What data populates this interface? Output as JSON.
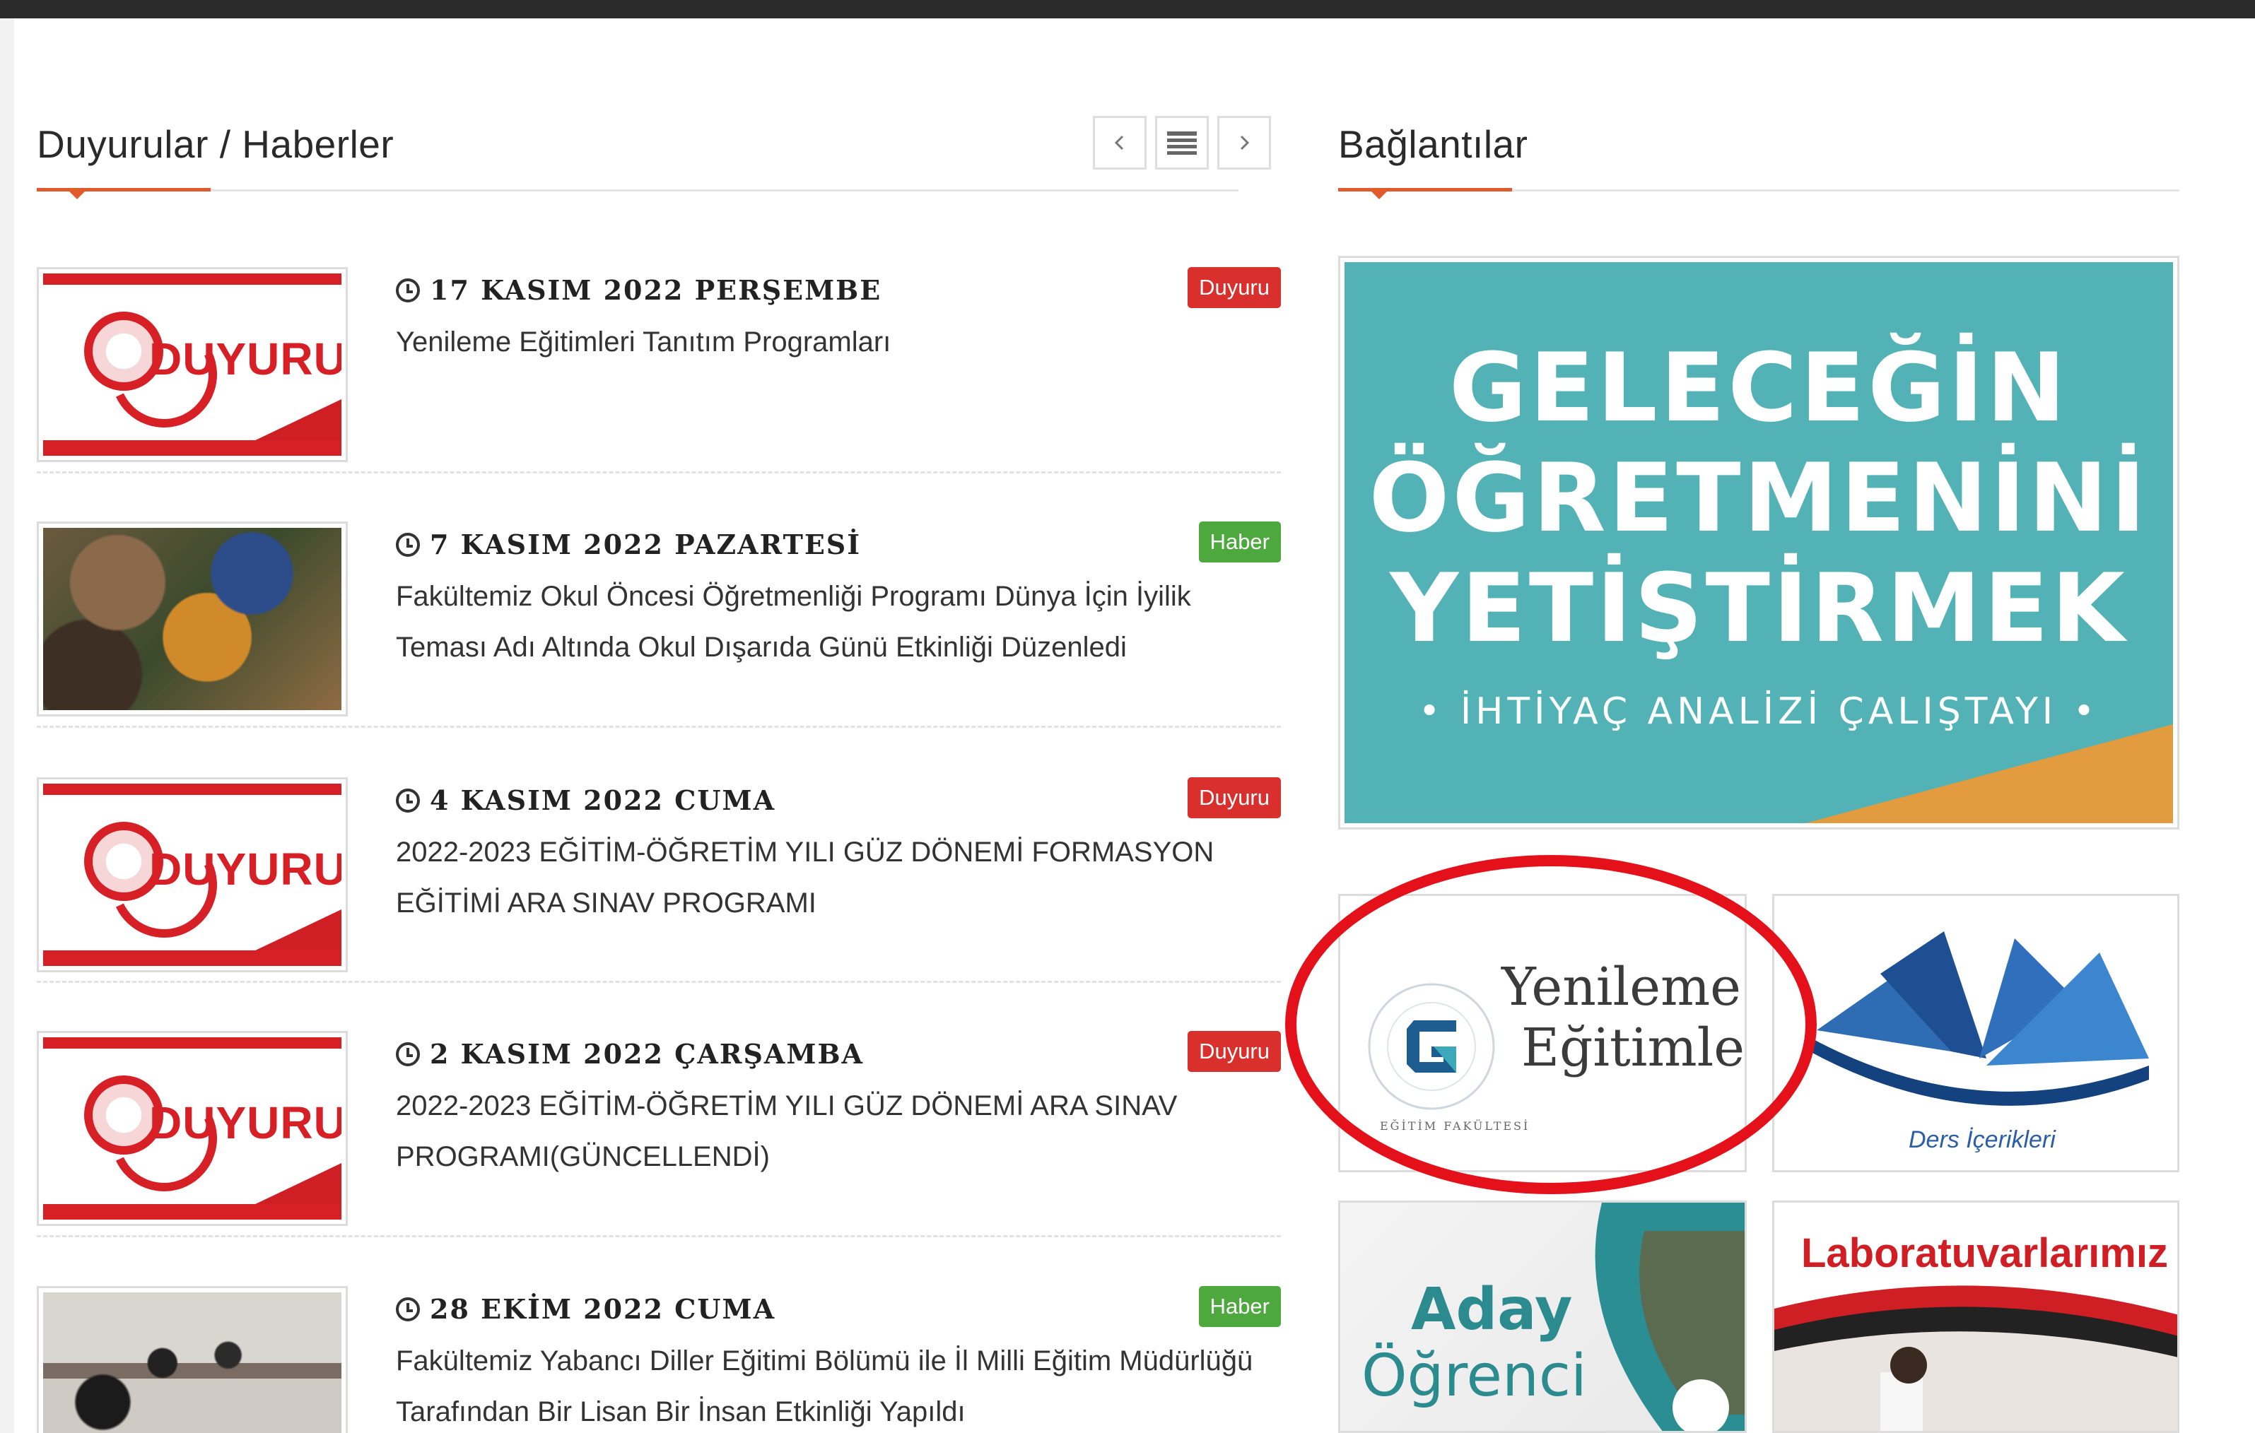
{
  "news": {
    "title": "Duyurular / Haberler",
    "nav": {
      "prev_icon": "chevron-left-icon",
      "list_icon": "list-icon",
      "next_icon": "chevron-right-icon"
    },
    "items": [
      {
        "thumb": "duyuru",
        "thumb_text": "DUYURU",
        "date": "17 KASIM 2022 PERŞEMBE",
        "headline": "Yenileme Eğitimleri Tanıtım Programları",
        "badge": "Duyuru",
        "badge_color": "#d9302d"
      },
      {
        "thumb": "photo",
        "date": "7 KASIM 2022 PAZARTESİ",
        "headline": "Fakültemiz Okul Öncesi Öğretmenliği Programı Dünya İçin İyilik Teması Adı Altında Okul Dışarıda Günü Etkinliği Düzenledi",
        "badge": "Haber",
        "badge_color": "#4da83e"
      },
      {
        "thumb": "duyuru",
        "thumb_text": "DUYURU",
        "date": "4 KASIM 2022 CUMA",
        "headline": "2022-2023 EĞİTİM-ÖĞRETİM YILI GÜZ DÖNEMİ FORMASYON EĞİTİMİ ARA SINAV PROGRAMI",
        "badge": "Duyuru",
        "badge_color": "#d9302d"
      },
      {
        "thumb": "duyuru",
        "thumb_text": "DUYURU",
        "date": "2 KASIM 2022 ÇARŞAMBA",
        "headline": "2022-2023 EĞİTİM-ÖĞRETİM YILI GÜZ DÖNEMİ ARA SINAV PROGRAMI(GÜNCELLENDİ)",
        "badge": "Duyuru",
        "badge_color": "#d9302d"
      },
      {
        "thumb": "photo",
        "date": "28 EKİM 2022 CUMA",
        "headline": "Fakültemiz Yabancı Diller Eğitimi Bölümü ile İl Milli Eğitim Müdürlüğü Tarafından Bir Lisan Bir İnsan Etkinliği Yapıldı",
        "badge": "Haber",
        "badge_color": "#4da83e"
      }
    ]
  },
  "links": {
    "title": "Bağlantılar",
    "banner": {
      "line1": "GELECEĞİN",
      "line2": "ÖĞRETMENİNİ",
      "line3": "YETİŞTİRMEK",
      "subtitle": "• İHTİYAÇ ANALİZİ ÇALIŞTAYI •",
      "bg": "#52b2b5",
      "accent": "#e39b3f"
    },
    "tiles": {
      "yenileme": {
        "line1": "Yenileme",
        "line2": "Eğitimleri",
        "logo_text": "EĞİTİM FAKÜLTESİ"
      },
      "ders": {
        "label": "Ders İçerikleri"
      },
      "aday": {
        "line1": "Aday",
        "line2": "Öğrenci"
      },
      "lab": {
        "label": "Laboratuvarlarımız"
      }
    }
  },
  "annotation": {
    "color": "#e5111a"
  }
}
